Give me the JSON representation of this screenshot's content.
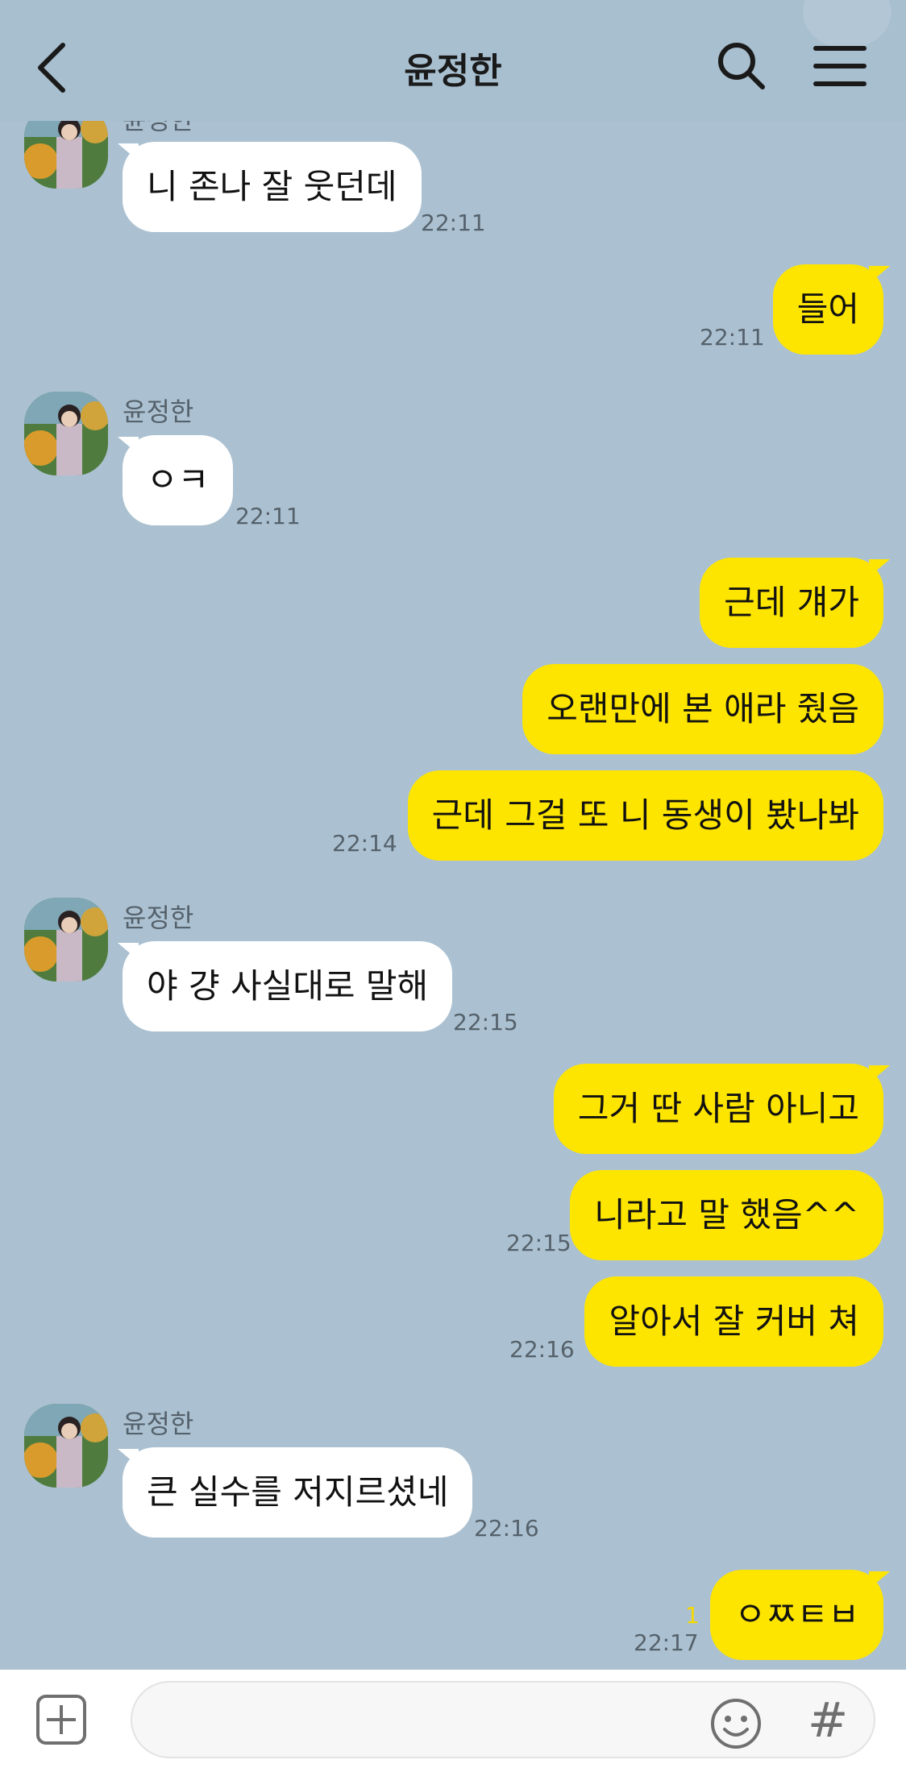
{
  "header": {
    "title": "윤정한",
    "back_icon": "chevron-left-icon",
    "search_icon": "search-icon",
    "menu_icon": "hamburger-menu-icon"
  },
  "messages": [
    {
      "side": "in",
      "sender": "윤정한",
      "text": "니 존나 잘 웃던데",
      "time": "22:11"
    },
    {
      "side": "out",
      "text": "들어",
      "time": "22:11"
    },
    {
      "side": "in",
      "sender": "윤정한",
      "text": "ㅇㅋ",
      "time": "22:11"
    },
    {
      "side": "out",
      "text": "근데 걔가",
      "time": ""
    },
    {
      "side": "out",
      "text": "오랜만에 본 애라 줬음",
      "time": ""
    },
    {
      "side": "out",
      "text": "근데 그걸 또 니 동생이 봤나봐",
      "time": "22:14"
    },
    {
      "side": "in",
      "sender": "윤정한",
      "text": "야 걍 사실대로 말해",
      "time": "22:15"
    },
    {
      "side": "out",
      "text": "그거 딴 사람 아니고",
      "time": ""
    },
    {
      "side": "out",
      "text": "니라고 말 했음^^",
      "time": "22:15"
    },
    {
      "side": "out",
      "text": "알아서 잘 커버 쳐",
      "time": "22:16"
    },
    {
      "side": "in",
      "sender": "윤정한",
      "text": "큰 실수를 저지르셨네",
      "time": "22:16"
    },
    {
      "side": "out",
      "text": "ㅇㅉㅌㅂ",
      "time": "22:17",
      "unread": "1"
    }
  ],
  "input_bar": {
    "placeholder": "",
    "attach_icon": "plus-square-icon",
    "emoji_icon": "emoji-icon",
    "hash_label": "#"
  },
  "colors": {
    "background": "#abc1d1",
    "outgoing_bubble": "#fee500",
    "incoming_bubble": "#ffffff",
    "unread": "#f5d800"
  }
}
